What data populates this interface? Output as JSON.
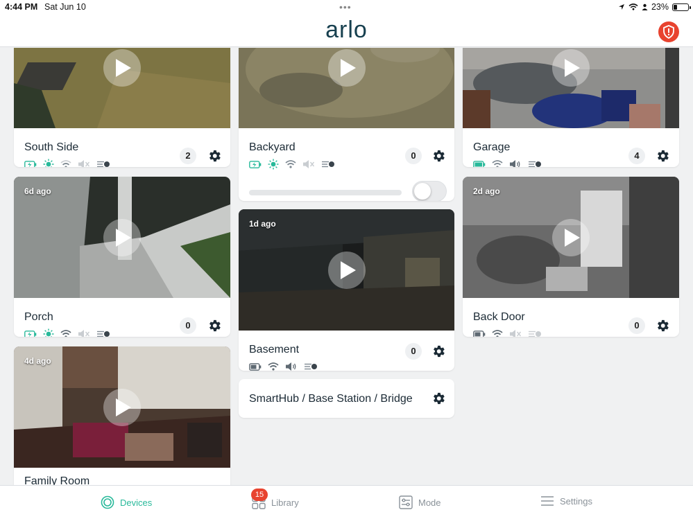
{
  "status_bar": {
    "time": "4:44 PM",
    "date": "Sat Jun 10",
    "battery": "23%",
    "battery_level": 0.23
  },
  "header": {
    "logo": "arlo",
    "alert_icon": "shield-alert-icon",
    "alert_color": "#e8432f"
  },
  "colors": {
    "accent": "#28b99a",
    "icon_gray": "#7f8a93",
    "muted_gray": "#c9cdd1"
  },
  "devices": [
    {
      "name": "South Side",
      "ago": "",
      "count": "2",
      "status_icons": [
        "battery-charging-icon",
        "sun-icon",
        "wifi-icon",
        "speaker-muted-icon",
        "motion-sensor-icon"
      ]
    },
    {
      "name": "Backyard",
      "ago": "",
      "count": "0",
      "status_icons": [
        "battery-charging-icon",
        "sun-icon",
        "wifi-icon",
        "speaker-muted-icon",
        "motion-sensor-icon"
      ],
      "toggle_on": false
    },
    {
      "name": "Garage",
      "ago": "",
      "count": "4",
      "status_icons": [
        "battery-charged-icon",
        "wifi-icon",
        "speaker-icon",
        "motion-sensor-icon"
      ]
    },
    {
      "name": "Porch",
      "ago": "6d ago",
      "count": "0",
      "status_icons": [
        "battery-charging-icon",
        "sun-icon",
        "wifi-icon",
        "speaker-muted-icon",
        "motion-sensor-icon"
      ]
    },
    {
      "name": "Basement",
      "ago": "1d ago",
      "count": "0",
      "status_icons": [
        "battery-icon",
        "wifi-icon",
        "speaker-icon",
        "motion-sensor-icon"
      ]
    },
    {
      "name": "Back Door",
      "ago": "2d ago",
      "count": "0",
      "status_icons": [
        "battery-icon",
        "wifi-icon",
        "speaker-muted-icon",
        "motion-sensor-off-icon"
      ]
    },
    {
      "name": "Family Room",
      "ago": "4d ago",
      "count": "",
      "status_icons": []
    }
  ],
  "hub": {
    "label": "SmartHub / Base Station / Bridge"
  },
  "tabs": [
    {
      "label": "Devices",
      "icon": "devices-icon",
      "active": true
    },
    {
      "label": "Library",
      "icon": "library-icon",
      "active": false,
      "badge": "15"
    },
    {
      "label": "Mode",
      "icon": "mode-icon",
      "active": false
    },
    {
      "label": "Settings",
      "icon": "menu-icon",
      "active": false
    }
  ]
}
